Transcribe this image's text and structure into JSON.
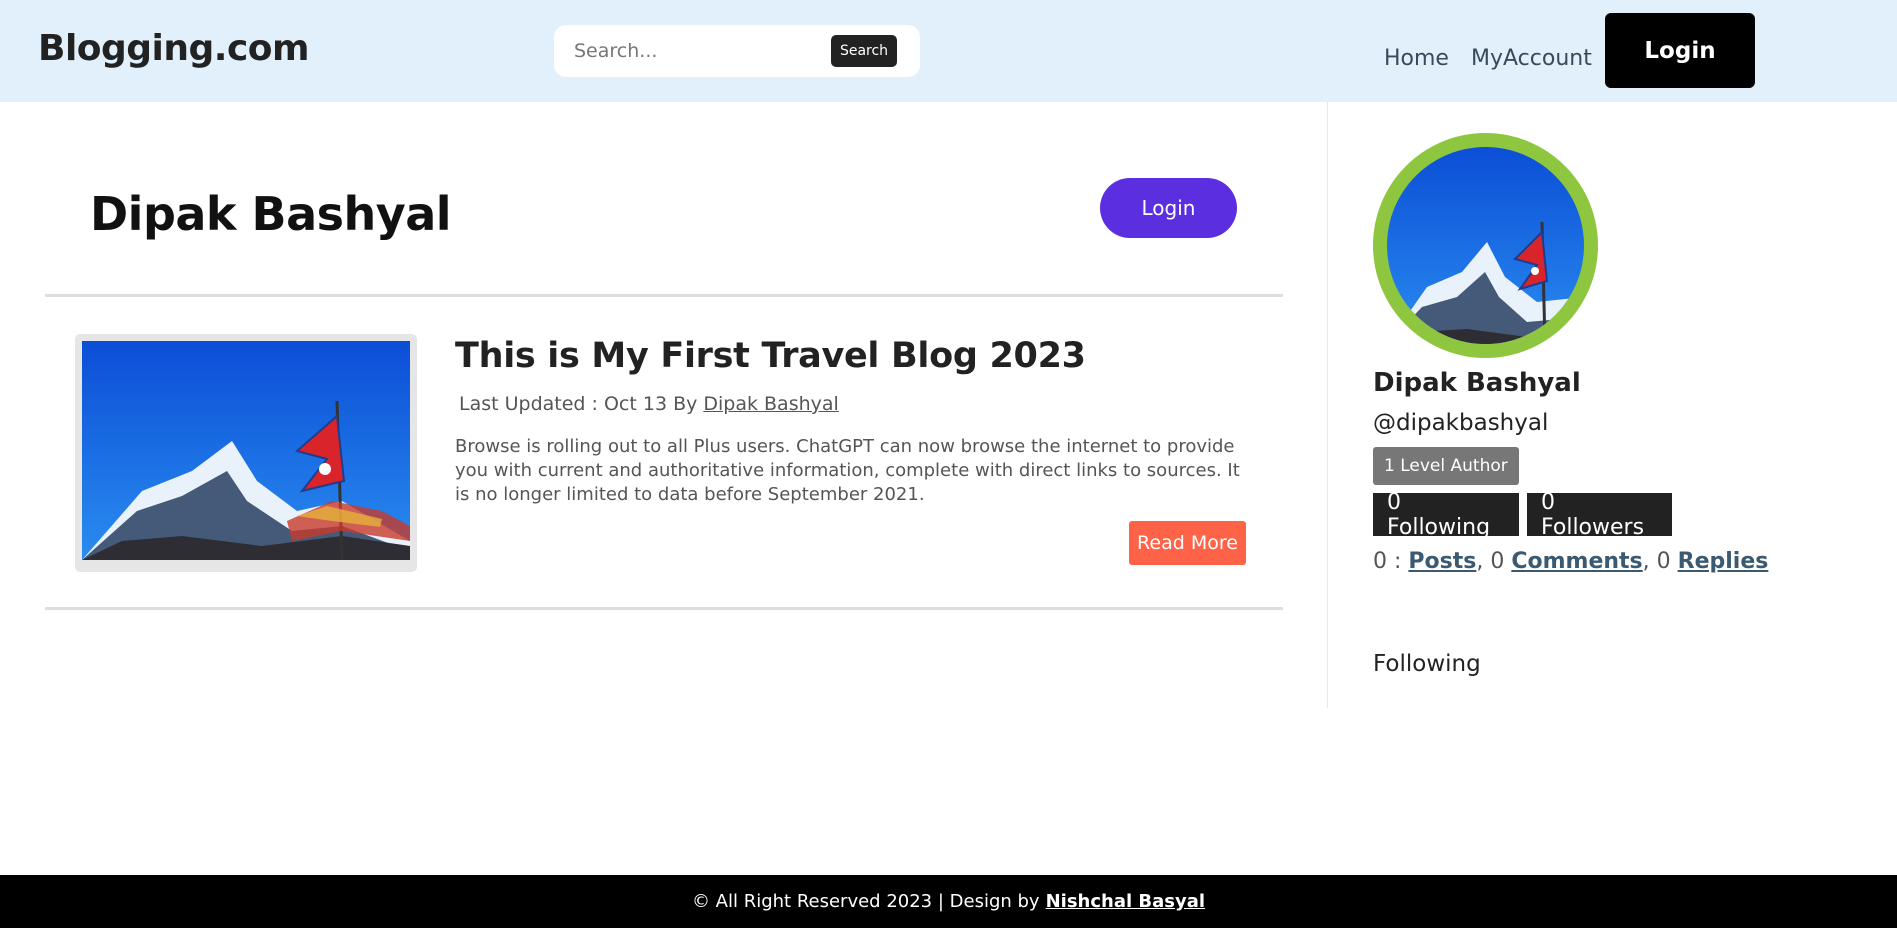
{
  "header": {
    "brand": "Blogging.com",
    "search_placeholder": "Search...",
    "search_button": "Search",
    "nav": {
      "home": "Home",
      "account": "MyAccount"
    },
    "login_button": "Login"
  },
  "profile": {
    "name": "Dipak Bashyal",
    "login_button": "Login"
  },
  "post": {
    "title": "This is My First Travel Blog 2023",
    "meta_prefix": "Last Updated : Oct 13 By",
    "author": "Dipak Bashyal",
    "excerpt": "Browse is rolling out to all Plus users. ChatGPT can now browse the internet to provide you with current and authoritative information, complete with direct links to sources. It is no longer limited to data before September 2021.",
    "read_more": "Read More"
  },
  "sidebar": {
    "name": "Dipak Bashyal",
    "handle": "@dipakbashyal",
    "level": "1 Level Author",
    "following": "0 Following",
    "followers": "0 Followers",
    "counts": {
      "posts_num": "0 :",
      "posts_label": "Posts",
      "comments_num": ", 0",
      "comments_label": "Comments",
      "replies_num": ", 0",
      "replies_label": "Replies"
    },
    "following_heading": "Following"
  },
  "footer": {
    "text": "© All Right Reserved 2023 | Design by",
    "designer": "Nishchal Basyal"
  },
  "colors": {
    "header_bg": "#e1f0fb",
    "main_login": "#5b2ee0",
    "read_more": "#ff6347",
    "avatar_ring": "#8ec63f"
  }
}
